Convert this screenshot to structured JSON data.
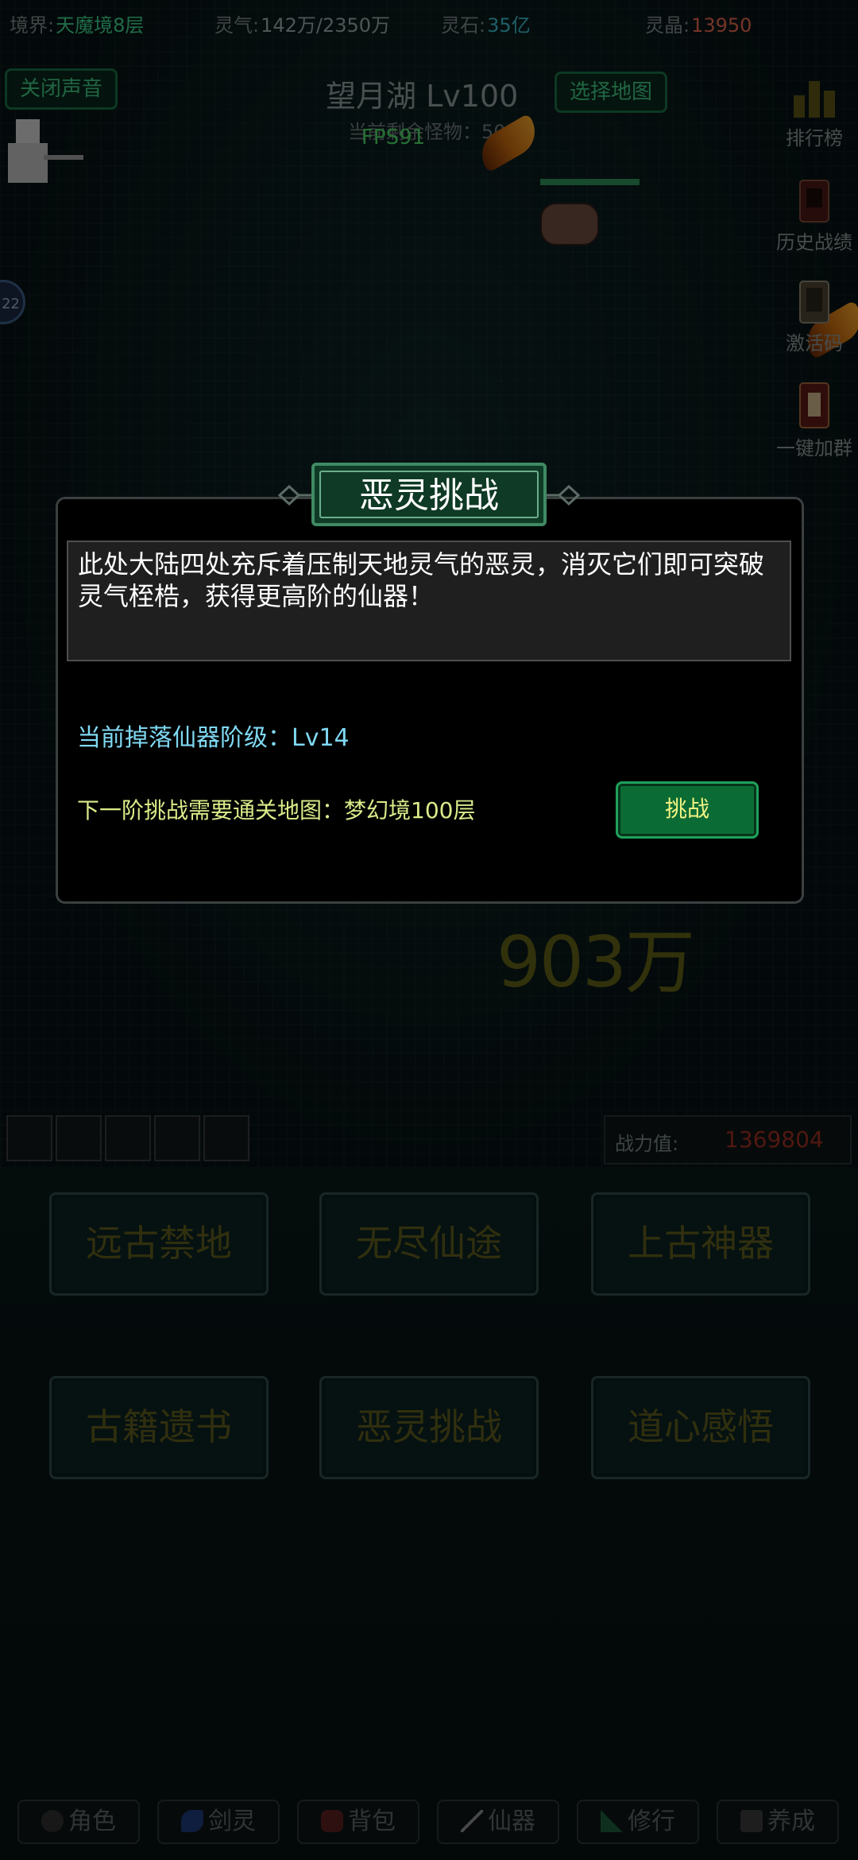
{
  "status": {
    "realm_label": "境界:",
    "realm_value": "天魔境8层",
    "lingqi_label": "灵气:",
    "lingqi_value": "142万/2350万",
    "lingshi_label": "灵石:",
    "lingshi_value": "35亿",
    "lingjing_label": "灵晶:",
    "lingjing_value": "13950"
  },
  "header": {
    "mute_button": "关闭声音",
    "map_title": "望月湖 Lv100",
    "map_button": "选择地图",
    "monsters_text": "当前剩余怪物：50",
    "fps": "FPS91"
  },
  "sidebar": {
    "items": [
      {
        "label": "排行榜",
        "icon": "bar-chart-icon"
      },
      {
        "label": "历史战绩",
        "icon": "scroll-icon"
      },
      {
        "label": "激活码",
        "icon": "card-icon"
      },
      {
        "label": "一键加群",
        "icon": "lantern-icon"
      }
    ]
  },
  "battle": {
    "avatar_badge": "22",
    "damage_text": "903万"
  },
  "modal": {
    "title": "恶灵挑战",
    "description": "此处大陆四处充斥着压制天地灵气的恶灵，消灭它们即可突破灵气桎梏，获得更高阶的仙器！",
    "drop_level": "当前掉落仙器阶级：Lv14",
    "next_requirement": "下一阶挑战需要通关地图：梦幻境100层",
    "challenge_button": "挑战"
  },
  "power": {
    "label": "战力值:",
    "value": "1369804"
  },
  "menu": {
    "items": [
      "远古禁地",
      "无尽仙途",
      "上古神器",
      "古籍遗书",
      "恶灵挑战",
      "道心感悟"
    ]
  },
  "tabs": {
    "items": [
      {
        "label": "角色",
        "icon": "character-icon"
      },
      {
        "label": "剑灵",
        "icon": "sword-spirit-icon"
      },
      {
        "label": "背包",
        "icon": "bag-icon"
      },
      {
        "label": "仙器",
        "icon": "artifact-icon"
      },
      {
        "label": "修行",
        "icon": "mountain-icon"
      },
      {
        "label": "养成",
        "icon": "cultivate-icon"
      }
    ]
  },
  "colors": {
    "accent_green": "#3fc27f",
    "challenge_button": "#0b6b34",
    "power_value": "#9c2f22",
    "modal_desc_bg": "#1f1f1f"
  }
}
